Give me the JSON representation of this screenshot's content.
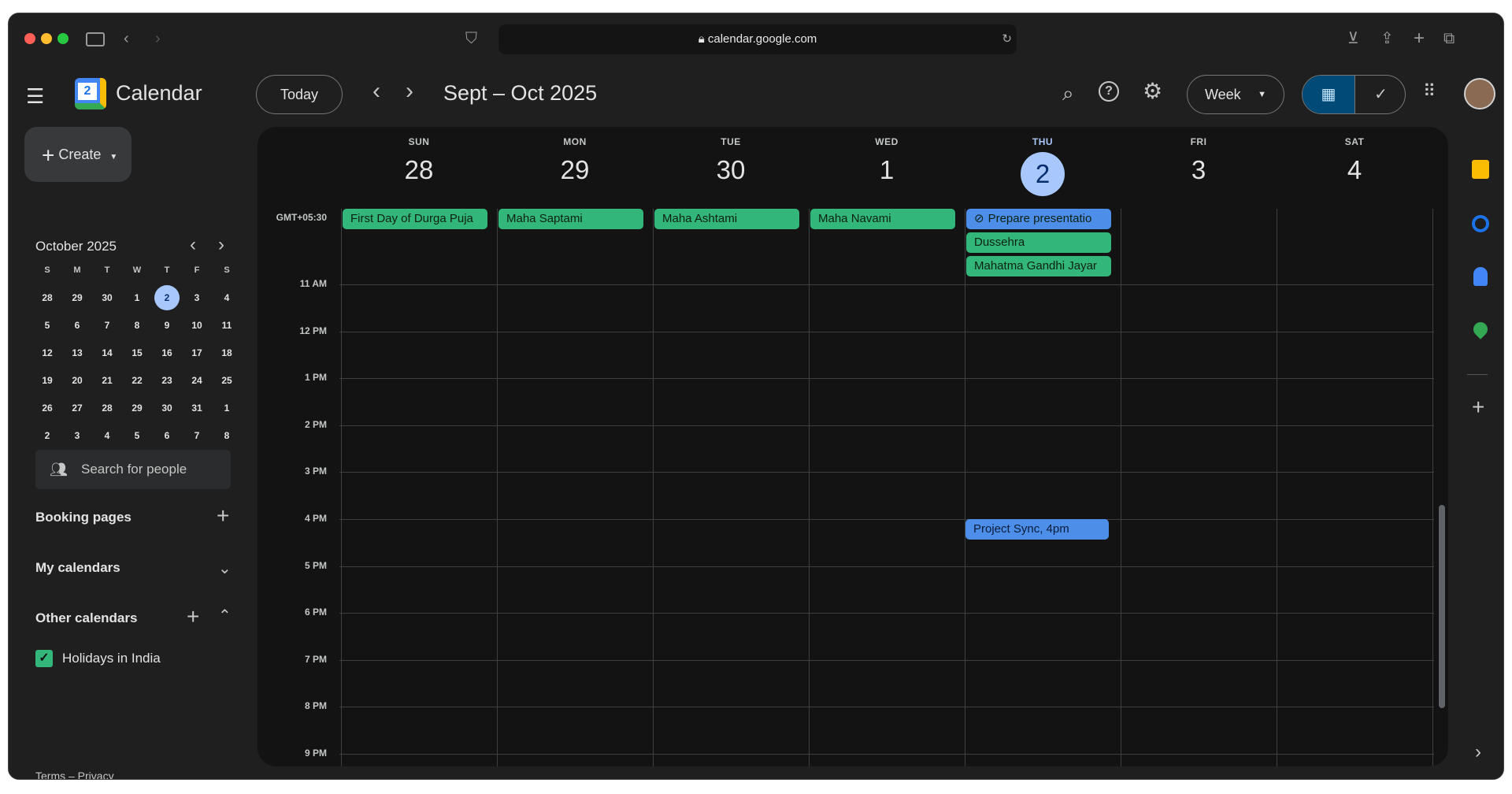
{
  "browser": {
    "url": "calendar.google.com"
  },
  "app": {
    "title": "Calendar",
    "logo_day": "2"
  },
  "toolbar": {
    "today": "Today",
    "range": "Sept – Oct 2025",
    "view": "Week"
  },
  "create": {
    "label": "Create"
  },
  "mini": {
    "month": "October 2025",
    "dows": [
      "S",
      "M",
      "T",
      "W",
      "T",
      "F",
      "S"
    ],
    "weeks": [
      [
        "28",
        "29",
        "30",
        "1",
        "2",
        "3",
        "4"
      ],
      [
        "5",
        "6",
        "7",
        "8",
        "9",
        "10",
        "11"
      ],
      [
        "12",
        "13",
        "14",
        "15",
        "16",
        "17",
        "18"
      ],
      [
        "19",
        "20",
        "21",
        "22",
        "23",
        "24",
        "25"
      ],
      [
        "26",
        "27",
        "28",
        "29",
        "30",
        "31",
        "1"
      ],
      [
        "2",
        "3",
        "4",
        "5",
        "6",
        "7",
        "8"
      ]
    ]
  },
  "sidebar": {
    "search_people": "Search for people",
    "booking": "Booking pages",
    "my_cals": "My calendars",
    "other_cals": "Other calendars",
    "holiday": "Holidays in India",
    "footer": "Terms – Privacy"
  },
  "days": [
    {
      "dow": "SUN",
      "date": "28"
    },
    {
      "dow": "MON",
      "date": "29"
    },
    {
      "dow": "TUE",
      "date": "30"
    },
    {
      "dow": "WED",
      "date": "1"
    },
    {
      "dow": "THU",
      "date": "2"
    },
    {
      "dow": "FRI",
      "date": "3"
    },
    {
      "dow": "SAT",
      "date": "4"
    }
  ],
  "timezone": "GMT+05:30",
  "hours": [
    "11 AM",
    "12 PM",
    "1 PM",
    "2 PM",
    "3 PM",
    "4 PM",
    "5 PM",
    "6 PM",
    "7 PM",
    "8 PM",
    "9 PM"
  ],
  "allday": [
    {
      "day": 0,
      "text": "First Day of Durga Puja",
      "color": "green"
    },
    {
      "day": 1,
      "text": "Maha Saptami",
      "color": "green"
    },
    {
      "day": 2,
      "text": "Maha Ashtami",
      "color": "green"
    },
    {
      "day": 3,
      "text": "Maha Navami",
      "color": "green"
    },
    {
      "day": 4,
      "text": "Prepare presentatio",
      "color": "blue",
      "task": true
    },
    {
      "day": 4,
      "text": "Dussehra",
      "color": "green"
    },
    {
      "day": 4,
      "text": "Mahatma Gandhi Jayar",
      "color": "green"
    }
  ],
  "timed": [
    {
      "day": 4,
      "text": "Project Sync, 4pm",
      "hour": "4 PM"
    }
  ],
  "colors": {
    "accent": "#a8c7fa",
    "event_green": "#33b679",
    "event_blue": "#4c8ee8"
  }
}
